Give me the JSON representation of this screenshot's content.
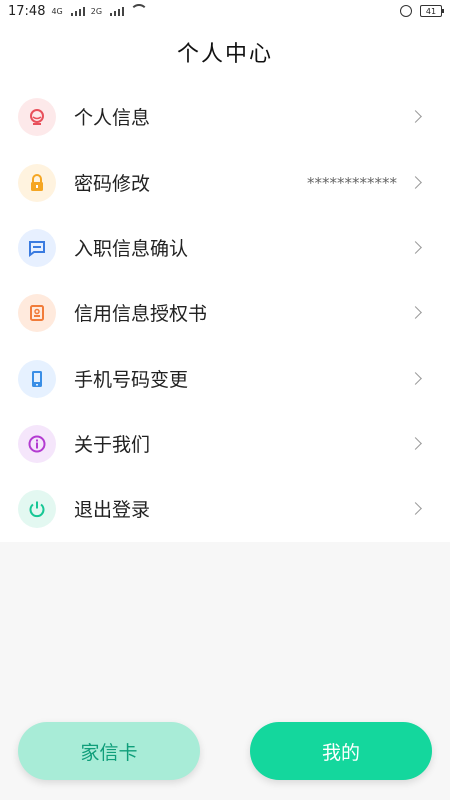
{
  "status_bar": {
    "time": "17:48",
    "net1": "4G",
    "net2": "2G",
    "battery": "41"
  },
  "header": {
    "title": "个人中心"
  },
  "menu": {
    "items": [
      {
        "label": "个人信息",
        "value": "",
        "icon": "user-avatar-icon",
        "icon_color": "#e8505b",
        "icon_bg": "#fde9ea"
      },
      {
        "label": "密码修改",
        "value": "************",
        "icon": "lock-icon",
        "icon_color": "#f5a623",
        "icon_bg": "#fff3df"
      },
      {
        "label": "入职信息确认",
        "value": "",
        "icon": "message-icon",
        "icon_color": "#3a7be0",
        "icon_bg": "#e7f0ff"
      },
      {
        "label": "信用信息授权书",
        "value": "",
        "icon": "id-card-icon",
        "icon_color": "#f17c3a",
        "icon_bg": "#ffeadd"
      },
      {
        "label": "手机号码变更",
        "value": "",
        "icon": "phone-icon",
        "icon_color": "#3a8ee6",
        "icon_bg": "#e6f1ff"
      },
      {
        "label": "关于我们",
        "value": "",
        "icon": "info-icon",
        "icon_color": "#b33bd1",
        "icon_bg": "#f5e6fb"
      },
      {
        "label": "退出登录",
        "value": "",
        "icon": "power-icon",
        "icon_color": "#17c795",
        "icon_bg": "#e3f8f1"
      }
    ]
  },
  "tabs": {
    "family_card": "家信卡",
    "mine": "我的"
  }
}
